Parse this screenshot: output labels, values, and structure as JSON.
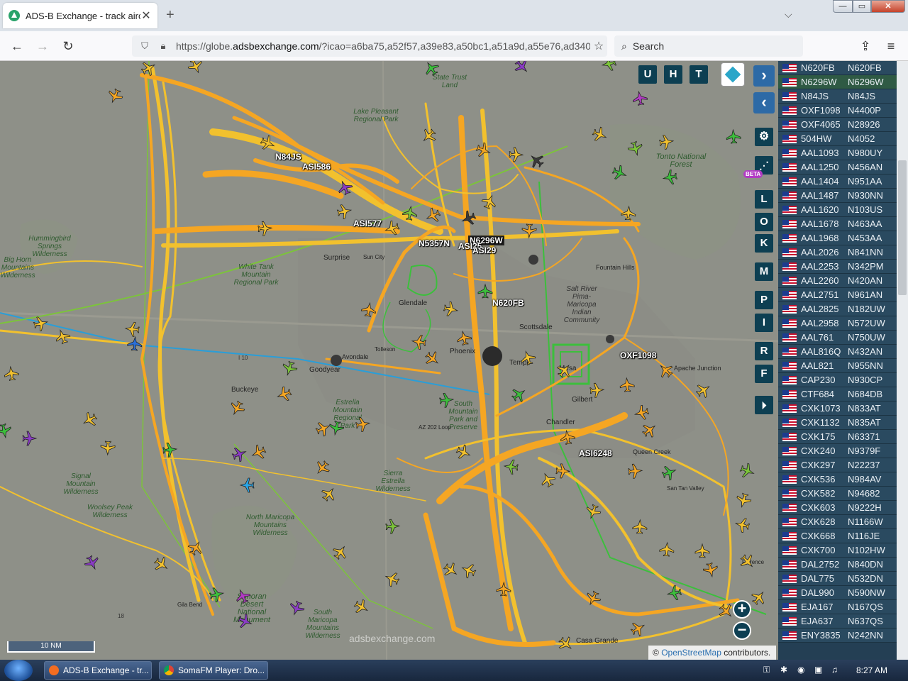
{
  "browser": {
    "tab_title": "ADS-B Exchange - track aircraft",
    "tab_close": "✕",
    "new_tab": "+",
    "tab_list": "⌵",
    "url_prefix": "https://globe.",
    "url_domain": "adsbexchange.com",
    "url_rest": "/?icao=a6ba75,a52f57,a39e83,a50bc1,a51a9d,a55e76,ad3408",
    "search_placeholder": "Search",
    "window_buttons": {
      "minimize": "—",
      "maximize": "▭",
      "close": "✕"
    }
  },
  "map": {
    "right_buttons": [
      "U",
      "H",
      "T"
    ],
    "side_buttons": [
      "L",
      "O",
      "K",
      "M",
      "P",
      "I",
      "R",
      "F"
    ],
    "beta_label": "BETA",
    "scale_label": "10 NM",
    "attribution_link": "OpenStreetMap",
    "attribution_text": " contributors.",
    "attribution_symbol": "©",
    "watermark": "adsbexchange.com",
    "zoom_in": "+",
    "zoom_out": "−",
    "arrow_right": "›",
    "arrow_left": "‹",
    "callsigns": [
      "N84JS",
      "ASI586",
      "ASI577",
      "N5357N",
      "N6296W",
      "ASI25",
      "ASI29",
      "N620FB",
      "OXF1098",
      "ASI6248"
    ],
    "places": [
      "State Trust Land",
      "Lake Pleasant Regional Park",
      "Tonto National Forest",
      "Hummingbird Springs Wilderness",
      "Big Horn Mountains Wilderness",
      "White Tank Mountain Regional Park",
      "Surprise",
      "Sun City",
      "Glendale",
      "Scottsdale",
      "Salt River Pima-Maricopa Indian Community",
      "Fountain Hills",
      "Tolleson",
      "Avondale",
      "Goodyear",
      "Buckeye",
      "Phoenix",
      "Tempe",
      "Mesa",
      "Gilbert",
      "Chandler",
      "Queen Creek",
      "Apache Junction",
      "Estrella Mountain Regional Park",
      "South Mountain Park and Preserve",
      "AZ 202 Loop",
      "Signal Mountain Wilderness",
      "Woolsey Peak Wilderness",
      "North Maricopa Mountains Wilderness",
      "Sierra Estrella Wilderness",
      "San Tan Valley",
      "Florence",
      "Casa Grande",
      "Gila Bend",
      "Sonoran Desert National Monument",
      "South Maricopa Mountains Wilderness",
      "I 10",
      "18"
    ]
  },
  "aircraft_list": [
    {
      "callsign": "N620FB",
      "reg": "N620FB"
    },
    {
      "callsign": "N6296W",
      "reg": "N6296W"
    },
    {
      "callsign": "N84JS",
      "reg": "N84JS"
    },
    {
      "callsign": "OXF1098",
      "reg": "N4400P"
    },
    {
      "callsign": "OXF4065",
      "reg": "N28926"
    },
    {
      "callsign": "504HW",
      "reg": "N4052"
    },
    {
      "callsign": "AAL1093",
      "reg": "N980UY"
    },
    {
      "callsign": "AAL1250",
      "reg": "N456AN"
    },
    {
      "callsign": "AAL1404",
      "reg": "N951AA"
    },
    {
      "callsign": "AAL1487",
      "reg": "N930NN"
    },
    {
      "callsign": "AAL1620",
      "reg": "N103US"
    },
    {
      "callsign": "AAL1678",
      "reg": "N463AA"
    },
    {
      "callsign": "AAL1968",
      "reg": "N453AA"
    },
    {
      "callsign": "AAL2026",
      "reg": "N841NN"
    },
    {
      "callsign": "AAL2253",
      "reg": "N342PM"
    },
    {
      "callsign": "AAL2260",
      "reg": "N420AN"
    },
    {
      "callsign": "AAL2751",
      "reg": "N961AN"
    },
    {
      "callsign": "AAL2825",
      "reg": "N182UW"
    },
    {
      "callsign": "AAL2958",
      "reg": "N572UW"
    },
    {
      "callsign": "AAL761",
      "reg": "N750UW"
    },
    {
      "callsign": "AAL816Q",
      "reg": "N432AN"
    },
    {
      "callsign": "AAL821",
      "reg": "N955NN"
    },
    {
      "callsign": "CAP230",
      "reg": "N930CP"
    },
    {
      "callsign": "CTF684",
      "reg": "N684DB"
    },
    {
      "callsign": "CXK1073",
      "reg": "N833AT"
    },
    {
      "callsign": "CXK1132",
      "reg": "N835AT"
    },
    {
      "callsign": "CXK175",
      "reg": "N63371"
    },
    {
      "callsign": "CXK240",
      "reg": "N9379F"
    },
    {
      "callsign": "CXK297",
      "reg": "N22237"
    },
    {
      "callsign": "CXK536",
      "reg": "N984AV"
    },
    {
      "callsign": "CXK582",
      "reg": "N94682"
    },
    {
      "callsign": "CXK603",
      "reg": "N9222H"
    },
    {
      "callsign": "CXK628",
      "reg": "N1166W"
    },
    {
      "callsign": "CXK668",
      "reg": "N116JE"
    },
    {
      "callsign": "CXK700",
      "reg": "N102HW"
    },
    {
      "callsign": "DAL2752",
      "reg": "N840DN"
    },
    {
      "callsign": "DAL775",
      "reg": "N532DN"
    },
    {
      "callsign": "DAL990",
      "reg": "N590NW"
    },
    {
      "callsign": "EJA167",
      "reg": "N167QS"
    },
    {
      "callsign": "EJA637",
      "reg": "N637QS"
    },
    {
      "callsign": "ENY3835",
      "reg": "N242NN"
    }
  ],
  "taskbar": {
    "items": [
      "ADS-B Exchange - tr...",
      "SomaFM Player: Dro..."
    ],
    "clock": "8:27 AM"
  },
  "colors": {
    "track_orange": "#f5a623",
    "track_yellow": "#f2c12e",
    "track_green": "#3cbf3c",
    "list_bg": "#243f54",
    "button_dark": "#0d3f52"
  }
}
